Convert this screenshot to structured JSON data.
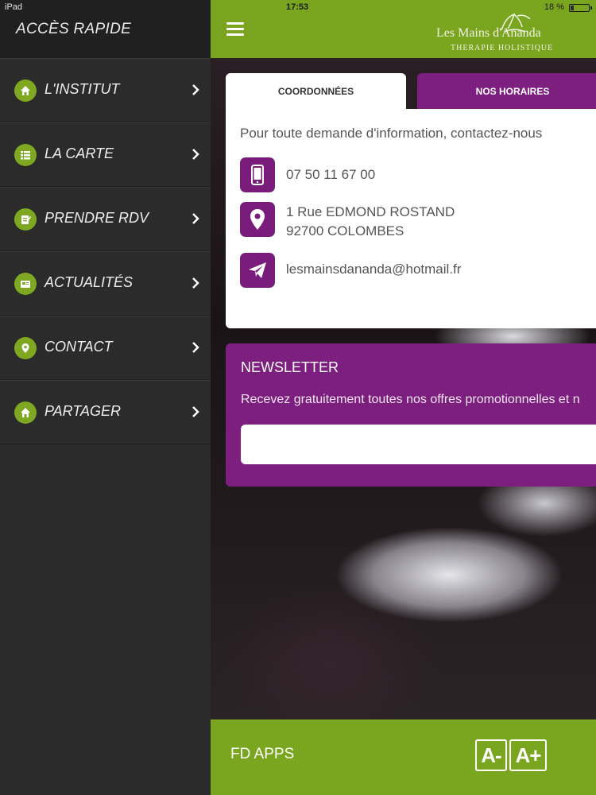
{
  "status_bar": {
    "carrier": "iPad",
    "time": "17:53",
    "battery": "18 %",
    "battery_fraction": 0.18
  },
  "sidebar": {
    "title": "ACCÈS RAPIDE",
    "items": [
      {
        "label": "L'INSTITUT",
        "icon": "home-icon"
      },
      {
        "label": "LA CARTE",
        "icon": "list-icon"
      },
      {
        "label": "PRENDRE RDV",
        "icon": "clipboard-icon"
      },
      {
        "label": "ACTUALITÉS",
        "icon": "news-icon"
      },
      {
        "label": "CONTACT",
        "icon": "location-pin-icon"
      },
      {
        "label": "PARTAGER",
        "icon": "home-icon"
      }
    ]
  },
  "header": {
    "brand": "Les Mains d'Ananda",
    "tagline": "THERAPIE HOLISTIQUE"
  },
  "tabs": [
    {
      "label": "COORDONNÉES",
      "active": true
    },
    {
      "label": "NOS HORAIRES",
      "active": false
    }
  ],
  "contact": {
    "intro": "Pour toute demande d'information, contactez-nous",
    "phone": "07 50 11 67 00",
    "address_line1": "1 Rue EDMOND ROSTAND",
    "address_line2": "92700 COLOMBES",
    "email": "lesmainsdananda@hotmail.fr"
  },
  "newsletter": {
    "title": "NEWSLETTER",
    "text": "Recevez gratuitement toutes nos offres promotionnelles et n",
    "input_value": ""
  },
  "footer": {
    "brand": "FD APPS",
    "font_decrease": "A-",
    "font_increase": "A+"
  },
  "colors": {
    "green": "#79a61e",
    "purple": "#7d1f7e",
    "sidebar": "#2b2b2b"
  }
}
